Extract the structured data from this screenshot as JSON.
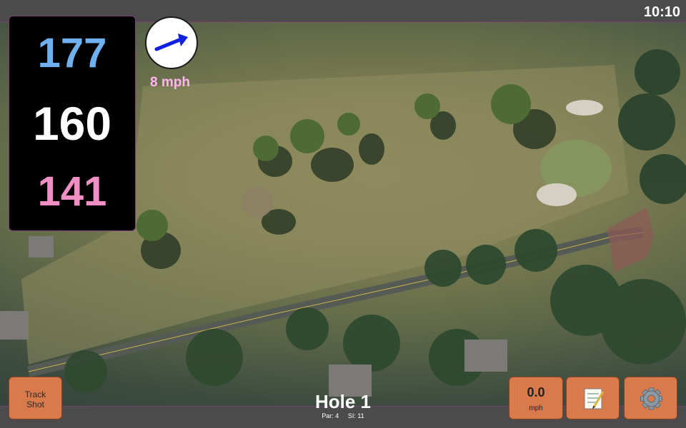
{
  "status": {
    "clock": "10:10"
  },
  "distances": {
    "back": "177",
    "middle": "160",
    "front": "141"
  },
  "wind": {
    "speed": "8 mph",
    "icon": "arrow-up-right-icon"
  },
  "hole": {
    "title": "Hole 1",
    "par": "Par: 4",
    "si": "SI: 11"
  },
  "buttons": {
    "track_shot_line1": "Track",
    "track_shot_line2": "Shot",
    "speed_value": "0.0",
    "speed_unit": "mph",
    "notes_icon": "notepad-icon",
    "settings_icon": "gear-icon"
  },
  "colors": {
    "back": "#6fb1ef",
    "middle": "#ffffff",
    "front": "#ef8fc3",
    "button": "#d97a4c",
    "accent": "#7a3c78",
    "wind_text": "#ffb6f0"
  }
}
